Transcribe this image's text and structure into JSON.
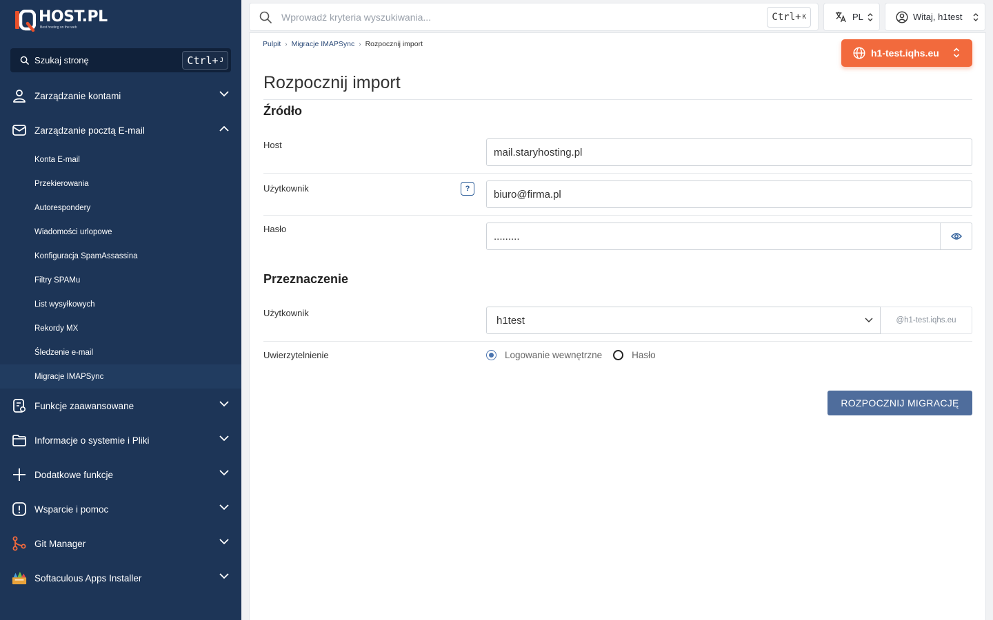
{
  "brand": {
    "name": "HOST.PL",
    "tagline": "Best hosting on the web"
  },
  "sidebar": {
    "search": {
      "label": "Szukaj stronę",
      "shortcut_main": "Ctrl+",
      "shortcut_key": "J"
    },
    "sections": [
      {
        "label": "Zarządzanie kontami",
        "icon": "user-icon",
        "expanded": false
      },
      {
        "label": "Zarządzanie pocztą E-mail",
        "icon": "mail-icon",
        "expanded": true,
        "items": [
          {
            "label": "Konta E-mail"
          },
          {
            "label": "Przekierowania"
          },
          {
            "label": "Autorespondery"
          },
          {
            "label": "Wiadomości urlopowe"
          },
          {
            "label": "Konfiguracja SpamAssassina"
          },
          {
            "label": "Filtry SPAMu"
          },
          {
            "label": "List wysyłkowych"
          },
          {
            "label": "Rekordy MX"
          },
          {
            "label": "Śledzenie e-mail"
          },
          {
            "label": "Migracje IMAPSync",
            "active": true
          }
        ]
      },
      {
        "label": "Funkcje zaawansowane",
        "icon": "advanced-settings-icon",
        "expanded": false
      },
      {
        "label": "Informacje o systemie i Pliki",
        "icon": "folder-icon",
        "expanded": false
      },
      {
        "label": "Dodatkowe funkcje",
        "icon": "plus-icon",
        "expanded": false
      },
      {
        "label": "Wsparcie i pomoc",
        "icon": "alert-icon",
        "expanded": false
      },
      {
        "label": "Git Manager",
        "icon": "git-icon",
        "expanded": false
      },
      {
        "label": "Softaculous Apps Installer",
        "icon": "softaculous-icon",
        "expanded": false
      }
    ]
  },
  "topbar": {
    "search_placeholder": "Wprowadź kryteria wyszukiwania...",
    "shortcut_main": "Ctrl+",
    "shortcut_key": "K",
    "language": "PL",
    "greeting": "Witaj, h1test"
  },
  "breadcrumb": [
    "Pulpit",
    "Migracje IMAPSync",
    "Rozpocznij import"
  ],
  "domain_selector": "h1-test.iqhs.eu",
  "page_title": "Rozpocznij import",
  "source": {
    "heading": "Źródło",
    "host_label": "Host",
    "host_value": "mail.staryhosting.pl",
    "user_label": "Użytkownik",
    "user_value": "biuro@firma.pl",
    "help_text": "?",
    "password_label": "Hasło",
    "password_value": "........."
  },
  "destination": {
    "heading": "Przeznaczenie",
    "user_label": "Użytkownik",
    "user_selected": "h1test",
    "domain_suffix": "@h1-test.iqhs.eu",
    "auth_label": "Uwierzytelnienie",
    "auth_options": [
      "Logowanie wewnętrzne",
      "Hasło"
    ],
    "auth_selected": "Logowanie wewnętrzne"
  },
  "submit_label": "ROZPOCZNIJ MIGRACJĘ",
  "colors": {
    "sidebar": "#1d3557",
    "accent_orange": "#f26a3d",
    "primary_button": "#4f6d9c",
    "brand_red": "#e8502a"
  }
}
